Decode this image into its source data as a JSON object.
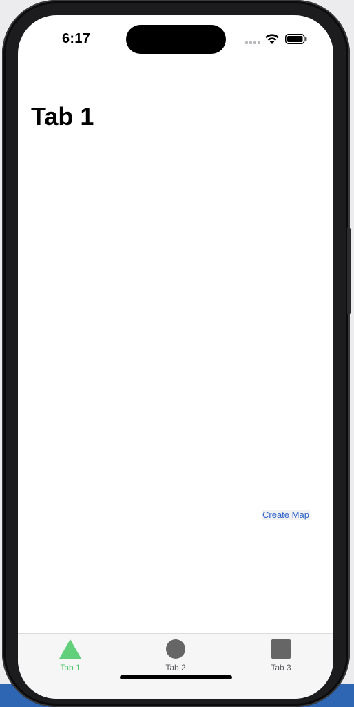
{
  "status_bar": {
    "time": "6:17"
  },
  "page": {
    "title": "Tab 1"
  },
  "actions": {
    "create_map_label": "Create Map"
  },
  "tab_bar": {
    "tabs": [
      {
        "label": "Tab 1",
        "icon": "triangle-icon",
        "active": true
      },
      {
        "label": "Tab 2",
        "icon": "circle-icon",
        "active": false
      },
      {
        "label": "Tab 3",
        "icon": "square-icon",
        "active": false
      }
    ]
  },
  "colors": {
    "accent": "#4fc46a",
    "link": "#2e63c9",
    "inactive_icon": "#666666"
  }
}
